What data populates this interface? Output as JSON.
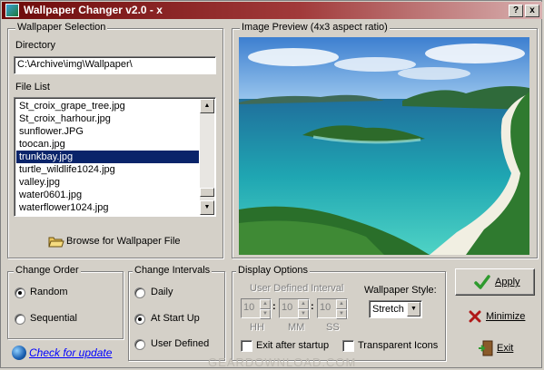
{
  "window": {
    "title": "Wallpaper Changer v2.0 - x",
    "controls": {
      "help": "?",
      "close": "x"
    }
  },
  "selection": {
    "group_title": "Wallpaper Selection",
    "directory_label": "Directory",
    "directory_value": "C:\\Archive\\img\\Wallpaper\\",
    "file_list_label": "File List",
    "files": [
      {
        "name": "St_croix_grape_tree.jpg",
        "selected": false
      },
      {
        "name": "St_croix_harhour.jpg",
        "selected": false
      },
      {
        "name": "sunflower.JPG",
        "selected": false
      },
      {
        "name": "toocan.jpg",
        "selected": false
      },
      {
        "name": "trunkbay.jpg",
        "selected": true
      },
      {
        "name": "turtle_wildlife1024.jpg",
        "selected": false
      },
      {
        "name": "valley.jpg",
        "selected": false
      },
      {
        "name": "water0601.jpg",
        "selected": false
      },
      {
        "name": "waterflower1024.jpg",
        "selected": false
      }
    ],
    "browse_label": "Browse for  Wallpaper File"
  },
  "preview": {
    "group_title": "Image Preview (4x3 aspect ratio)"
  },
  "change_order": {
    "group_title": "Change Order",
    "options": [
      {
        "label": "Random",
        "checked": true
      },
      {
        "label": "Sequential",
        "checked": false
      }
    ]
  },
  "change_intervals": {
    "group_title": "Change Intervals",
    "options": [
      {
        "label": "Daily",
        "checked": false
      },
      {
        "label": "At Start Up",
        "checked": true
      },
      {
        "label": "User Defined",
        "checked": false
      }
    ]
  },
  "display_options": {
    "group_title": "Display Options",
    "interval_label": "User Defined Interval",
    "hh": "10",
    "mm": "10",
    "ss": "10",
    "hh_label": "HH",
    "mm_label": "MM",
    "ss_label": "SS",
    "separator": ":",
    "style_label": "Wallpaper Style:",
    "style_value": "Stretch",
    "exit_after_startup": "Exit after startup",
    "transparent_icons": "Transparent Icons"
  },
  "actions": {
    "apply": "Apply",
    "minimize": "Minimize",
    "exit": "Exit"
  },
  "footer": {
    "check_update": "Check for update",
    "watermark": "GEARDOWNLOAD.COM"
  },
  "colors": {
    "title_start": "#6d0a0a",
    "selection": "#0a246a",
    "link": "#0000ff",
    "apply_check": "#2e9a2e",
    "minimize_x": "#b01818"
  }
}
